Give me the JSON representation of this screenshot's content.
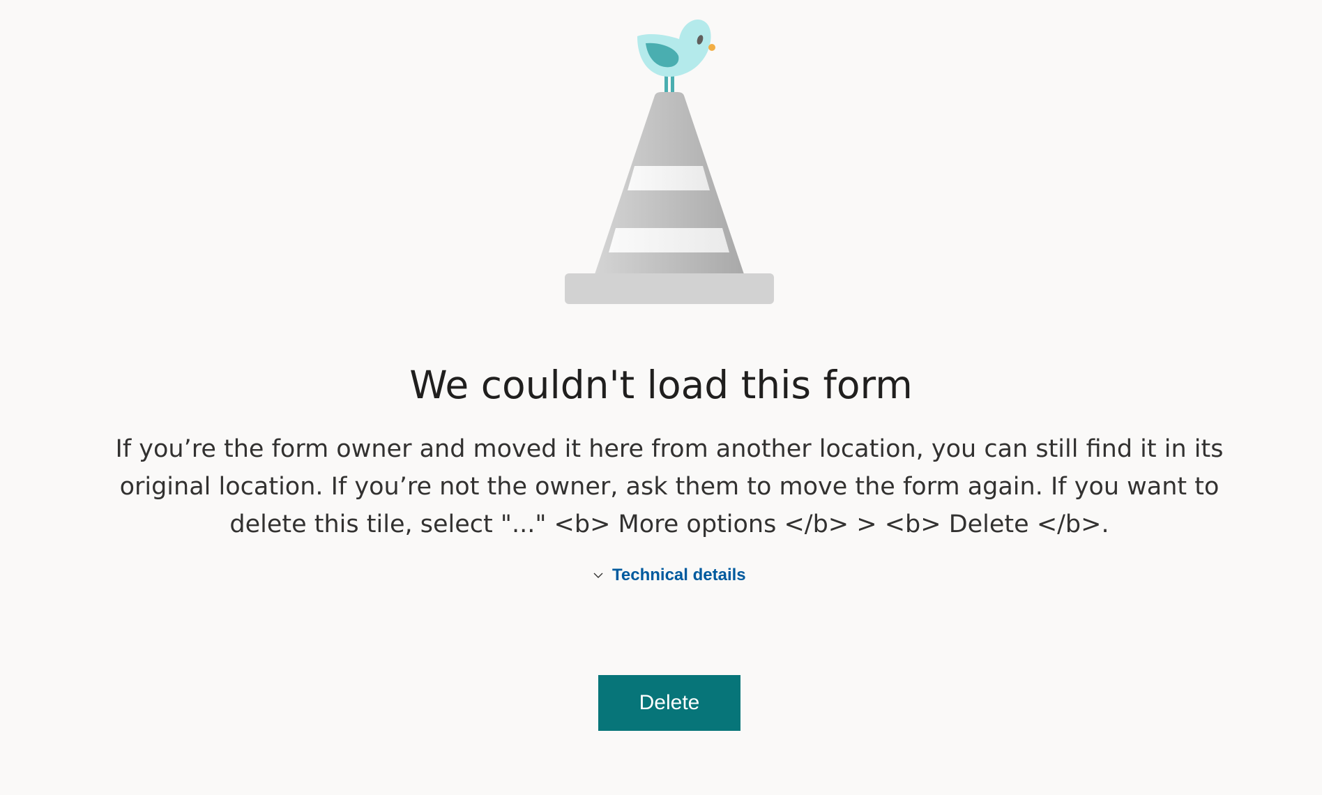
{
  "error": {
    "title": "We couldn't load this form",
    "message": "If you’re the form owner and moved it here from another location, you can still find it in its original location. If you’re not the owner, ask them to move the form again. If you want to delete this tile, select \"...\" <b> More options </b> > <b> Delete </b>."
  },
  "technical_details": {
    "label": "Technical details",
    "icon": "chevron-down-icon"
  },
  "actions": {
    "delete_label": "Delete"
  },
  "illustration": {
    "name": "traffic-cone-with-bird",
    "colors": {
      "cone": "#c8c8c8",
      "stripe": "#f3f2f1",
      "base": "#d2d2d2",
      "bird_body": "#b4eaeb",
      "bird_wing": "#4aaeb0",
      "beak": "#f2ae45"
    }
  },
  "colors": {
    "background": "#faf9f8",
    "link": "#005a9e",
    "button": "#077579"
  }
}
